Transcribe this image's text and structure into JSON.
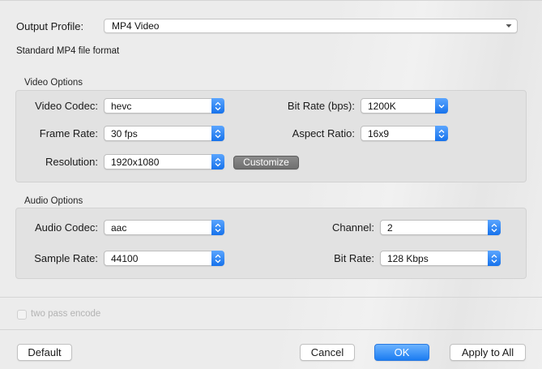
{
  "output_profile": {
    "label": "Output Profile:",
    "value": "MP4 Video",
    "description": "Standard MP4 file format"
  },
  "video_options": {
    "title": "Video Options",
    "video_codec": {
      "label": "Video Codec:",
      "value": "hevc"
    },
    "frame_rate": {
      "label": "Frame Rate:",
      "value": "30 fps"
    },
    "resolution": {
      "label": "Resolution:",
      "value": "1920x1080"
    },
    "customize_label": "Customize",
    "bit_rate": {
      "label": "Bit Rate (bps):",
      "value": "1200K"
    },
    "aspect_ratio": {
      "label": "Aspect Ratio:",
      "value": "16x9"
    }
  },
  "audio_options": {
    "title": "Audio Options",
    "audio_codec": {
      "label": "Audio Codec:",
      "value": "aac"
    },
    "sample_rate": {
      "label": "Sample Rate:",
      "value": "44100"
    },
    "channel": {
      "label": "Channel:",
      "value": "2"
    },
    "bit_rate": {
      "label": "Bit Rate:",
      "value": "128 Kbps"
    }
  },
  "two_pass": {
    "label": "two pass encode",
    "checked": false,
    "enabled": false
  },
  "buttons": {
    "default": "Default",
    "cancel": "Cancel",
    "ok": "OK",
    "apply_to_all": "Apply to All"
  },
  "colors": {
    "accent": "#1b7cf1",
    "window_bg": "#ececec",
    "group_bg": "#e2e2e2"
  }
}
